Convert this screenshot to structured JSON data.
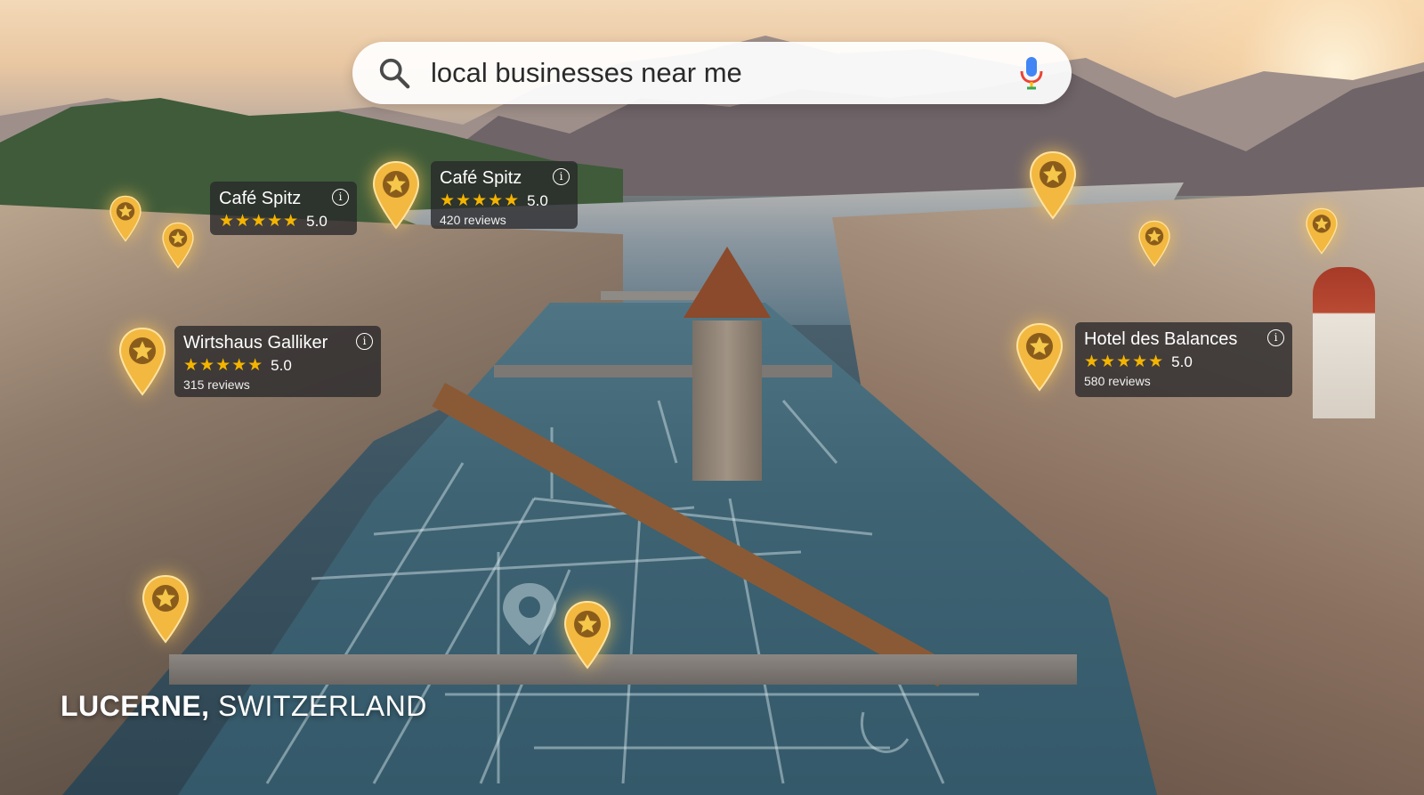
{
  "search": {
    "query": "local businesses near me",
    "icon": "search-icon",
    "mic_icon": "mic-icon"
  },
  "businesses": [
    {
      "name": "Café Spitz",
      "stars": "★★★★★",
      "rating": "5.0",
      "reviews": ""
    },
    {
      "name": "Café Spitz",
      "stars": "★★★★★",
      "rating": "5.0",
      "reviews": "420 reviews"
    },
    {
      "name": "Wirtshaus Galliker",
      "stars": "★★★★★",
      "rating": "5.0",
      "reviews": "315 reviews"
    },
    {
      "name": "Hotel des Balances",
      "stars": "★★★★★",
      "rating": "5.0",
      "reviews": "580 reviews"
    }
  ],
  "info_glyph": "i",
  "location": {
    "city": "LUCERNE,",
    "country": " SWITZERLAND"
  },
  "colors": {
    "pin_gold": "#f2b840",
    "star_yellow": "#f4b400",
    "card_bg": "#28282a"
  }
}
